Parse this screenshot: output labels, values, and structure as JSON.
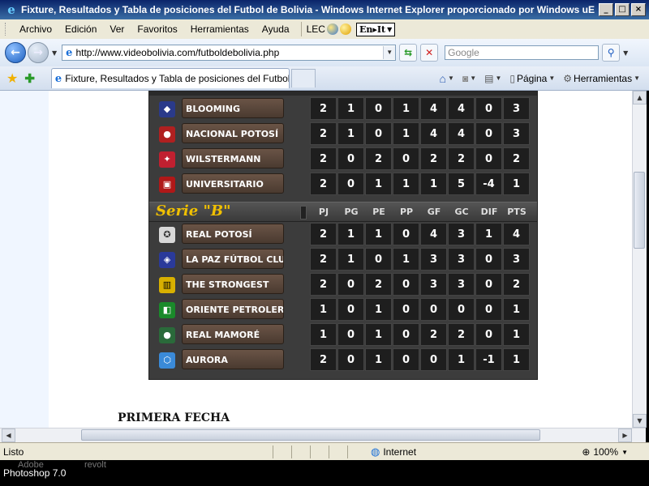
{
  "window": {
    "title": "Fixture, Resultados y Tabla de posiciones del Futbol de Bolivia - Windows Internet Explorer proporcionado por Windows uE",
    "min": "_",
    "max": "□",
    "close": "×"
  },
  "menu": {
    "items": [
      "Archivo",
      "Edición",
      "Ver",
      "Favoritos",
      "Herramientas",
      "Ayuda"
    ],
    "lec": "LEC",
    "enit": "En▸It"
  },
  "address": {
    "url": "http://www.videobolivia.com/futboldebolivia.php",
    "search_placeholder": "Google"
  },
  "tabs": {
    "active": "Fixture, Resultados y Tabla de posiciones del Futbol d...",
    "pagina": "Página",
    "herramientas": "Herramientas"
  },
  "standings": {
    "serie_a_rows": [
      {
        "team": "BLOOMING",
        "stats": [
          "2",
          "1",
          "0",
          "1",
          "4",
          "4",
          "0",
          "3"
        ],
        "color": "#2a3a8a"
      },
      {
        "team": "NACIONAL POTOSÍ",
        "stats": [
          "2",
          "1",
          "0",
          "1",
          "4",
          "4",
          "0",
          "3"
        ],
        "color": "#b02020"
      },
      {
        "team": "WILSTERMANN",
        "stats": [
          "2",
          "0",
          "2",
          "0",
          "2",
          "2",
          "0",
          "2"
        ],
        "color": "#c02030"
      },
      {
        "team": "UNIVERSITARIO",
        "stats": [
          "2",
          "0",
          "1",
          "1",
          "1",
          "5",
          "-4",
          "1"
        ],
        "color": "#b01818"
      }
    ],
    "serie_b": {
      "label": "Serie  \"B\"",
      "headers": [
        "PJ",
        "PG",
        "PE",
        "PP",
        "GF",
        "GC",
        "DIF",
        "PTS"
      ]
    },
    "serie_b_rows": [
      {
        "team": "REAL POTOSÍ",
        "stats": [
          "2",
          "1",
          "1",
          "0",
          "4",
          "3",
          "1",
          "4"
        ],
        "color": "#d8d8d8"
      },
      {
        "team": "LA PAZ FÚTBOL CLUB",
        "stats": [
          "2",
          "1",
          "0",
          "1",
          "3",
          "3",
          "0",
          "3"
        ],
        "color": "#2a3a9a"
      },
      {
        "team": "THE STRONGEST",
        "stats": [
          "2",
          "0",
          "2",
          "0",
          "3",
          "3",
          "0",
          "2"
        ],
        "color": "#d8b000"
      },
      {
        "team": "ORIENTE PETROLERO",
        "stats": [
          "1",
          "0",
          "1",
          "0",
          "0",
          "0",
          "0",
          "1"
        ],
        "color": "#1a8a2a"
      },
      {
        "team": "REAL MAMORÉ",
        "stats": [
          "1",
          "0",
          "1",
          "0",
          "2",
          "2",
          "0",
          "1"
        ],
        "color": "#2a6a3a"
      },
      {
        "team": "AURORA",
        "stats": [
          "2",
          "0",
          "1",
          "0",
          "0",
          "1",
          "-1",
          "1"
        ],
        "color": "#3a8ad8"
      }
    ]
  },
  "primera_fecha": "PRIMERA FECHA",
  "status": {
    "text": "Listo",
    "zone": "Internet",
    "zoom": "100%"
  },
  "taskbar": {
    "adobe": "Adobe",
    "revolt": "revolt",
    "photoshop": "Photoshop 7.0"
  }
}
